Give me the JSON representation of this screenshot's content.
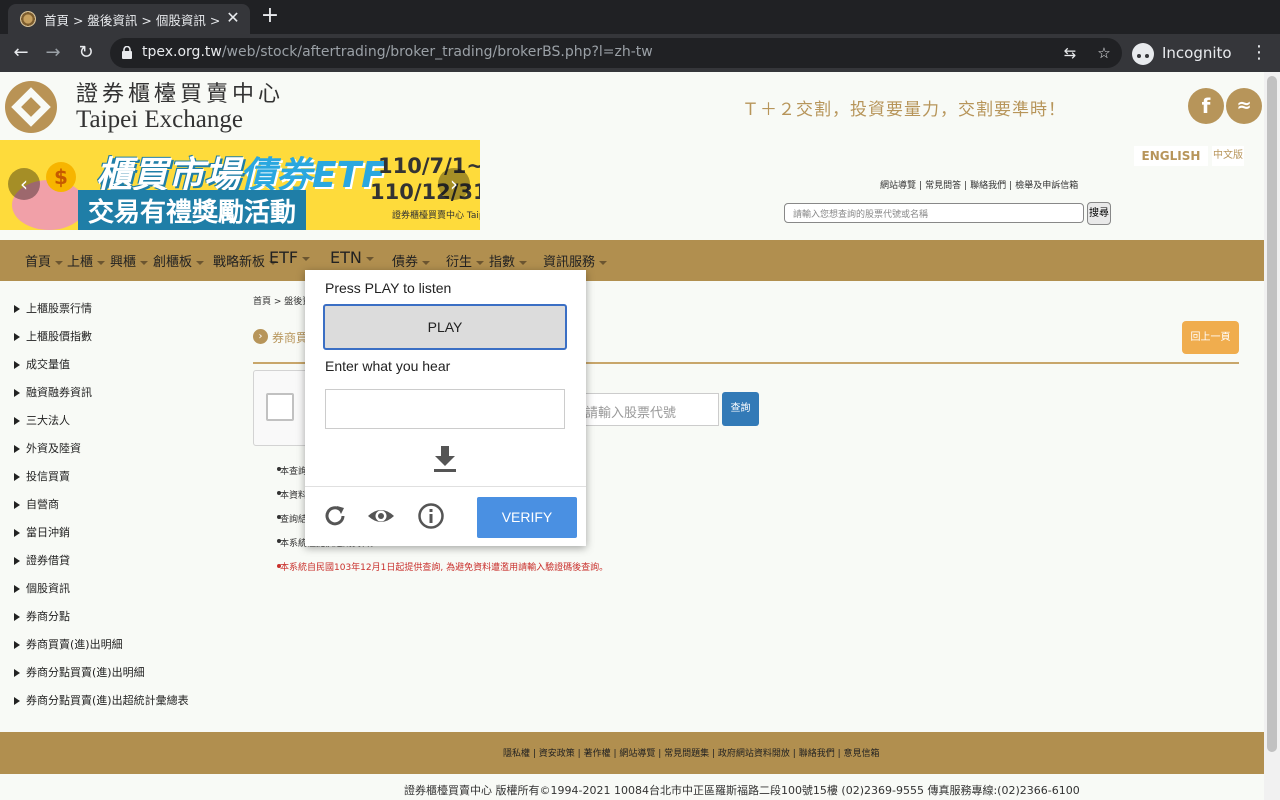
{
  "browser": {
    "tab_title": "首頁 > 盤後資訊 > 個股資訊 > 券商買賣證券日報表查詢系統",
    "tab_close": "✕",
    "new_tab": "+",
    "url_host": "tpex.org.tw",
    "url_path": "/web/stock/aftertrading/broker_trading/brokerBS.php?l=zh-tw",
    "incognito_label": "Incognito"
  },
  "header": {
    "logo_zh": "證券櫃檯買賣中心",
    "logo_en": "Taipei Exchange",
    "slogan": "Ｔ＋２交割，投資要量力，交割要準時！",
    "facebook": "f",
    "rss": "≈"
  },
  "banner": {
    "line1_a": "櫃買市場",
    "line1_b": "債券ETF",
    "line2": "交易有禮獎勵活動",
    "date1": "110/7/1~",
    "date2": "110/12/31",
    "small": "證券櫃檯買賣中心 Taipei Exchange",
    "coin": "$"
  },
  "lang": {
    "en": "ENGLISH",
    "zh": "中文版"
  },
  "quicklinks": [
    "網站導覽",
    "常見問答",
    "聯絡我們",
    "檢舉及申訴信箱"
  ],
  "site_search": {
    "placeholder": "請輸入您想查詢的股票代號或名稱",
    "button": "搜尋"
  },
  "nav": [
    "首頁",
    "上櫃",
    "興櫃",
    "創櫃板",
    "戰略新板",
    "ETF",
    "ETN",
    "債券",
    "衍生",
    "指數",
    "資訊服務"
  ],
  "sidebar": [
    "上櫃股票行情",
    "上櫃股價指數",
    "成交量值",
    "融資融券資訊",
    "三大法人",
    "外資及陸資",
    "投信買賣",
    "自營商",
    "當日沖銷",
    "證券借貸",
    "個股資訊",
    "券商分點",
    "券商買賣(進)出明細",
    "券商分點買賣(進)出明細",
    "券商分點買賣(進)出超統計彙總表"
  ],
  "breadcrumb": "首頁 > 盤後資訊 >",
  "page_title": "券商買賣證券日報表查詢系統",
  "orange_btn": "回上一頁",
  "query": {
    "placeholder": "請輸入股票代號",
    "button": "查詢"
  },
  "notes": [
    "本查詢資料供參考，不作投資依據。",
    "本資料於每日交易結束後更新。",
    "查詢結果以交易日為準。",
    "本系統僅提供近期資料。"
  ],
  "red_note": "本系統自民國103年12月1日起提供查詢, 為避免資料遭濫用請輸入驗證碼後查詢。",
  "footer_links": [
    "隱私權",
    "資安政策",
    "著作權",
    "網站導覽",
    "常見問題集",
    "政府網站資料開放",
    "聯絡我們",
    "意見信箱"
  ],
  "copyright": "證券櫃檯買賣中心 版權所有©1994-2021  10084台北市中正區羅斯福路二段100號15樓 (02)2369-9555 傳真服務專線:(02)2366-6100",
  "captcha": {
    "title": "Press PLAY to listen",
    "play": "PLAY",
    "subtitle": "Enter what you hear",
    "verify": "VERIFY"
  }
}
